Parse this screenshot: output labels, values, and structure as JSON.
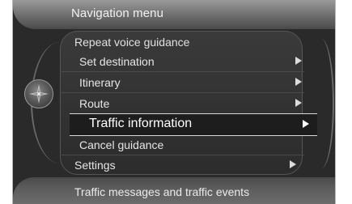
{
  "header": {
    "title": "Navigation menu"
  },
  "menu": {
    "items": [
      {
        "label": "Repeat voice guidance",
        "has_submenu": false
      },
      {
        "label": "Set destination",
        "has_submenu": true
      },
      {
        "label": "Itinerary",
        "has_submenu": true
      },
      {
        "label": "Route",
        "has_submenu": true
      },
      {
        "label": "Traffic information",
        "has_submenu": true,
        "selected": true
      },
      {
        "label": "Cancel guidance",
        "has_submenu": false
      },
      {
        "label": "Settings",
        "has_submenu": true
      }
    ]
  },
  "footer": {
    "text": "Traffic messages and traffic events"
  },
  "icons": {
    "left_emblem": "compass-star-icon",
    "submenu": "triangle-right-icon"
  },
  "colors": {
    "background": "#2a2a2a",
    "text": "#e6e6e6",
    "highlight_border": "#d8d8d8"
  }
}
